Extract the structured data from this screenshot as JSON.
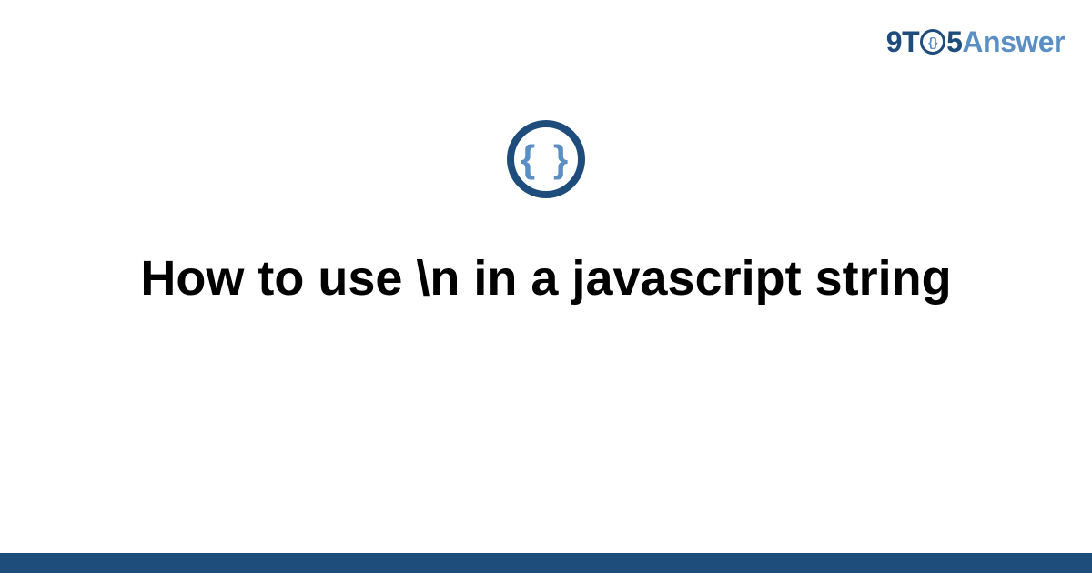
{
  "brand": {
    "part1": "9T",
    "o_inner": "{}",
    "part2": "5",
    "part3": "Answer"
  },
  "icon": {
    "name": "code-braces-icon",
    "glyph": "{ }"
  },
  "title": "How to use \\n in a javascript string",
  "colors": {
    "primary": "#1e4d7b",
    "accent": "#5a8fc4"
  }
}
